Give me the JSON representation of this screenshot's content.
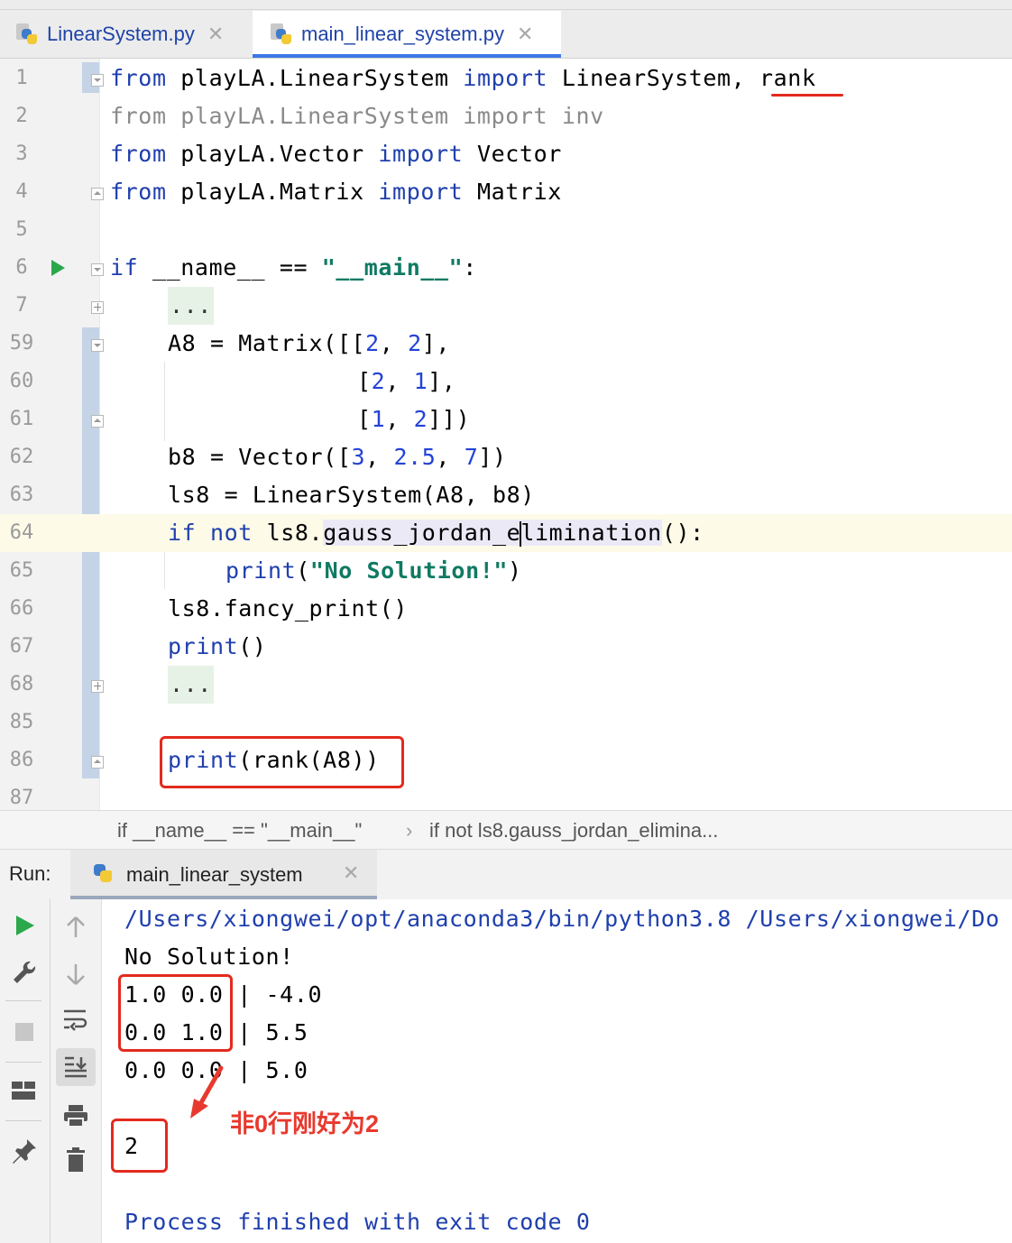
{
  "tabs": [
    {
      "label": "LinearSystem.py",
      "active": false
    },
    {
      "label": "main_linear_system.py",
      "active": true
    }
  ],
  "editor": {
    "current_line": "64",
    "lines": [
      {
        "num": "1"
      },
      {
        "num": "2"
      },
      {
        "num": "3"
      },
      {
        "num": "4"
      },
      {
        "num": "5"
      },
      {
        "num": "6"
      },
      {
        "num": "7"
      },
      {
        "num": "59"
      },
      {
        "num": "60"
      },
      {
        "num": "61"
      },
      {
        "num": "62"
      },
      {
        "num": "63"
      },
      {
        "num": "64"
      },
      {
        "num": "65"
      },
      {
        "num": "66"
      },
      {
        "num": "67"
      },
      {
        "num": "68"
      },
      {
        "num": "85"
      },
      {
        "num": "86"
      },
      {
        "num": "87"
      }
    ],
    "code": {
      "l1_from": "from",
      "l1_mod": " playLA.LinearSystem ",
      "l1_import": "import",
      "l1_names": " LinearSystem, ",
      "l1_rank": "rank",
      "l2": "from playLA.LinearSystem import inv",
      "l3_from": "from",
      "l3_mod": " playLA.Vector ",
      "l3_import": "import",
      "l3_names": " Vector",
      "l4_from": "from",
      "l4_mod": " playLA.Matrix ",
      "l4_import": "import",
      "l4_names": " Matrix",
      "l6_if": "if",
      "l6_mid": " __name__ == ",
      "l6_str": "\"__main__\"",
      "l6_end": ":",
      "fold_placeholder": "...",
      "l59_a": "A8 = Matrix([[",
      "l59_n1": "2",
      "l59_c": ", ",
      "l59_n2": "2",
      "l59_e": "],",
      "l60_a": "[",
      "l60_n1": "2",
      "l60_c": ", ",
      "l60_n2": "1",
      "l60_e": "],",
      "l61_a": "[",
      "l61_n1": "1",
      "l61_c": ", ",
      "l61_n2": "2",
      "l61_e": "]])",
      "l62_a": "b8 = Vector([",
      "l62_n1": "3",
      "l62_c1": ", ",
      "l62_n2": "2.5",
      "l62_c2": ", ",
      "l62_n3": "7",
      "l62_e": "])",
      "l63": "ls8 = LinearSystem(A8, b8)",
      "l64_if": "if",
      "l64_not": " not",
      "l64_obj": " ls8.",
      "l64_m1": "gauss_jordan_e",
      "l64_m2": "limination",
      "l64_end": "():",
      "l65_print": "print",
      "l65_open": "(",
      "l65_str": "\"No Solution!\"",
      "l65_close": ")",
      "l66": "ls8.fancy_print()",
      "l67_print": "print",
      "l67_end": "()",
      "l86_print": "print",
      "l86_end": "(rank(A8))"
    }
  },
  "breadcrumb": {
    "item1": "if __name__ == \"__main__\"",
    "sep": "›",
    "item2": "if not ls8.gauss_jordan_elimina..."
  },
  "run": {
    "label": "Run:",
    "tab_name": "main_linear_system",
    "console": [
      "/Users/xiongwei/opt/anaconda3/bin/python3.8 /Users/xiongwei/Do",
      "No Solution!",
      "1.0 0.0 | -4.0",
      "0.0 1.0 | 5.5",
      "0.0 0.0 | 5.0",
      "",
      "2",
      "",
      "Process finished with exit code 0"
    ]
  },
  "annotation": "非0行刚好为2",
  "colors": {
    "keyword": "#1f3fad",
    "number": "#2343d6",
    "string": "#107a63",
    "highlight_red": "#e32a1e",
    "run_green": "#2aa84a"
  }
}
